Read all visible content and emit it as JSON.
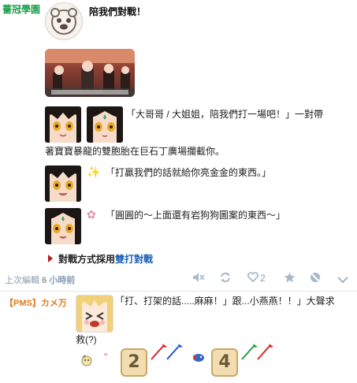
{
  "post": {
    "author": "薔冠學園",
    "title": "陪我們對戰！",
    "dialogue1": "「大哥哥 / 大姐姐，陪我們打一場吧！」一對帶",
    "dialogue1_cont": "著寶寶暴龍的雙胞胎在巨石丁廣場攔截你。",
    "dialogue2": "「打贏我們的話就給你亮金金的東西。」",
    "dialogue3": "「圓圓的～上面還有岩狗狗圖案的東西～」",
    "battle_prefix": "對戰方式採用",
    "battle_link": "雙打對戰"
  },
  "meta": {
    "last_edit_label": "上次編輯",
    "last_edit_value": "6 小時前",
    "like_count": "2",
    "icons": [
      "mute-icon",
      "retweet-icon",
      "heart-icon",
      "star-icon",
      "block-icon",
      "chevron-down-icon"
    ]
  },
  "comment": {
    "author": "【PMS】カメ万",
    "text": "「打、打架的話.....麻麻！」跟...小燕燕！！」大聲求",
    "text_cont": "救(?)",
    "dice": [
      "2",
      "4"
    ]
  },
  "colors": {
    "author_green": "#1a9e4a",
    "link_blue": "#1d5fb8",
    "comment_orange": "#e07a1f"
  }
}
